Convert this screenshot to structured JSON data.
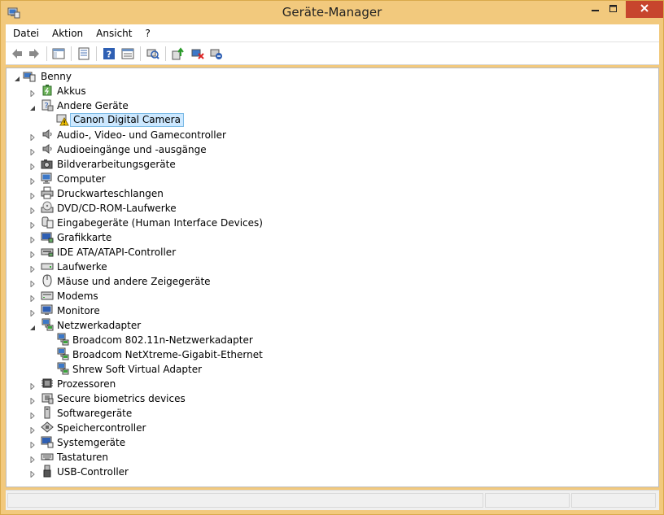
{
  "window": {
    "title": "Geräte-Manager",
    "minimize_icon": "minimize-icon",
    "maximize_icon": "maximize-icon",
    "close_icon": "close-icon"
  },
  "menu": [
    "Datei",
    "Aktion",
    "Ansicht",
    "?"
  ],
  "toolbar": {
    "buttons": [
      "back",
      "forward",
      "properties-view",
      "properties",
      "help",
      "details-view",
      "scan-hardware",
      "update-driver",
      "disable-device",
      "uninstall-device"
    ]
  },
  "tree": {
    "root": "Benny",
    "items": [
      {
        "label": "Akkus",
        "expanded": false,
        "icon": "battery-icon"
      },
      {
        "label": "Andere Geräte",
        "expanded": true,
        "icon": "unknown-device-icon",
        "children": [
          {
            "label": "Canon Digital Camera",
            "icon": "warning-device-icon",
            "selected": true
          }
        ]
      },
      {
        "label": "Audio-, Video- und Gamecontroller",
        "expanded": false,
        "icon": "speaker-icon"
      },
      {
        "label": "Audioeingänge und -ausgänge",
        "expanded": false,
        "icon": "speaker-icon"
      },
      {
        "label": "Bildverarbeitungsgeräte",
        "expanded": false,
        "icon": "camera-icon"
      },
      {
        "label": "Computer",
        "expanded": false,
        "icon": "computer-icon"
      },
      {
        "label": "Druckwarteschlangen",
        "expanded": false,
        "icon": "printer-icon"
      },
      {
        "label": "DVD/CD-ROM-Laufwerke",
        "expanded": false,
        "icon": "dvd-drive-icon"
      },
      {
        "label": "Eingabegeräte (Human Interface Devices)",
        "expanded": false,
        "icon": "hid-icon"
      },
      {
        "label": "Grafikkarte",
        "expanded": false,
        "icon": "display-adapter-icon"
      },
      {
        "label": "IDE ATA/ATAPI-Controller",
        "expanded": false,
        "icon": "ide-controller-icon"
      },
      {
        "label": "Laufwerke",
        "expanded": false,
        "icon": "disk-drive-icon"
      },
      {
        "label": "Mäuse und andere Zeigegeräte",
        "expanded": false,
        "icon": "mouse-icon"
      },
      {
        "label": "Modems",
        "expanded": false,
        "icon": "modem-icon"
      },
      {
        "label": "Monitore",
        "expanded": false,
        "icon": "monitor-icon"
      },
      {
        "label": "Netzwerkadapter",
        "expanded": true,
        "icon": "network-adapter-icon",
        "children": [
          {
            "label": "Broadcom 802.11n-Netzwerkadapter",
            "icon": "network-adapter-icon"
          },
          {
            "label": "Broadcom NetXtreme-Gigabit-Ethernet",
            "icon": "network-adapter-icon"
          },
          {
            "label": "Shrew Soft Virtual Adapter",
            "icon": "network-adapter-icon"
          }
        ]
      },
      {
        "label": "Prozessoren",
        "expanded": false,
        "icon": "processor-icon"
      },
      {
        "label": "Secure biometrics devices",
        "expanded": false,
        "icon": "biometric-icon"
      },
      {
        "label": "Softwaregeräte",
        "expanded": false,
        "icon": "software-device-icon"
      },
      {
        "label": "Speichercontroller",
        "expanded": false,
        "icon": "storage-controller-icon"
      },
      {
        "label": "Systemgeräte",
        "expanded": false,
        "icon": "system-device-icon"
      },
      {
        "label": "Tastaturen",
        "expanded": false,
        "icon": "keyboard-icon"
      },
      {
        "label": "USB-Controller",
        "expanded": false,
        "icon": "usb-icon"
      }
    ]
  },
  "colors": {
    "frame": "#f2c97d",
    "close_button": "#c7452d",
    "selection": "#cce8ff",
    "selection_border": "#7dbbe6"
  }
}
